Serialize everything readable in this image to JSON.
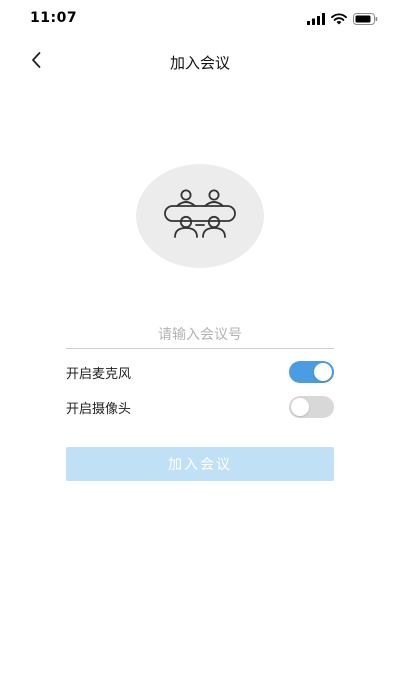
{
  "status_bar": {
    "time": "11:07",
    "signal_icon": "signal-bars-icon",
    "wifi_icon": "wifi-icon",
    "battery_icon": "battery-icon"
  },
  "header": {
    "back_icon": "chevron-left-icon",
    "title": "加入会议"
  },
  "illustration": {
    "icon": "meeting-table-icon"
  },
  "form": {
    "meeting_number": {
      "value": "",
      "placeholder": "请输入会议号"
    },
    "microphone": {
      "label": "开启麦克风",
      "enabled": true
    },
    "camera": {
      "label": "开启摄像头",
      "enabled": false
    },
    "join_button": {
      "label": "加入会议",
      "disabled": true
    }
  },
  "colors": {
    "toggle_on": "#4a9de1",
    "toggle_off": "#d8d8d8",
    "join_button_disabled": "#bfe0f5",
    "illustration_bg": "#ececec"
  }
}
